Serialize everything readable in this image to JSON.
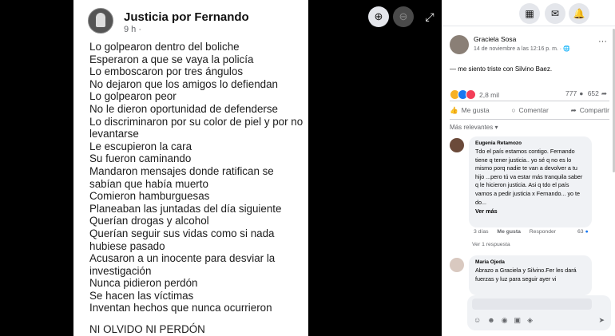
{
  "viewer": {
    "post_author": "Justicia por Fernando",
    "post_time": "9 h ·",
    "lines": [
      "Lo golpearon dentro del boliche",
      "Esperaron a que se vaya la policía",
      "Lo emboscaron por tres ángulos",
      "No dejaron que los amigos lo defiendan",
      "Lo golpearon peor",
      "No le dieron oportunidad de defenderse",
      "Lo discriminaron por su color de piel y por no levantarse",
      "Le escupieron la cara",
      "Su fueron caminando",
      "Mandaron mensajes donde ratifican se sabían que había muerto",
      "Comieron hamburguesas",
      "Planeaban las juntadas del día siguiente",
      "Querían drogas y alcohol",
      "Querían seguir sus vidas como si nada hubiese pasado",
      "Acusaron a un inocente para desviar la investigación",
      "Nunca pidieron perdón",
      "Se hacen las víctimas",
      "Inventan hechos que nunca ocurrieron"
    ],
    "final": "NI OLVIDO NI PERDÓN",
    "zoom_in": "⊕",
    "zoom_out": "⊖",
    "fullscreen": "⤢"
  },
  "topbar": {
    "menu": "▦",
    "messenger": "✉",
    "bell": "🔔"
  },
  "post": {
    "author": "Graciela Sosa",
    "date": "14 de noviembre a las 12:16 p. m. · 🌐",
    "more": "···",
    "text_prefix": "— me siento triste con ",
    "text_mention": "Silvino Baez",
    "text_suffix": ".",
    "reaction_count": "2,8 mil",
    "comments_count": "777",
    "shares_count": "652",
    "like": "Me gusta",
    "comment": "Comentar",
    "share": "Compartir",
    "relevant": "Más relevantes ▾"
  },
  "comments": [
    {
      "author": "Eugenia Retamozo",
      "text": "Tdo el país estamos contigo. Fernando tiene q tener justicia.. yo sé q no es lo mismo porq nadie te van a devolver a tu hijo ...pero tú va estar más tranquila saber q le hicieron justicia. Asi q tdo el país vamos a pedir justicia x Fernando... yo te do...",
      "more": "Ver más",
      "time": "3 días",
      "like": "Me gusta",
      "reply": "Responder",
      "count": "63",
      "replies": "Ver 1 respuesta"
    },
    {
      "author": "Maria Ojeda",
      "text": "Abrazo a Graciela y Silvino.Fer les dará fuerzas y luz para seguir ayer vi"
    }
  ],
  "colors": {
    "accent": "#1877f2",
    "bubble": "#f0f2f5"
  }
}
